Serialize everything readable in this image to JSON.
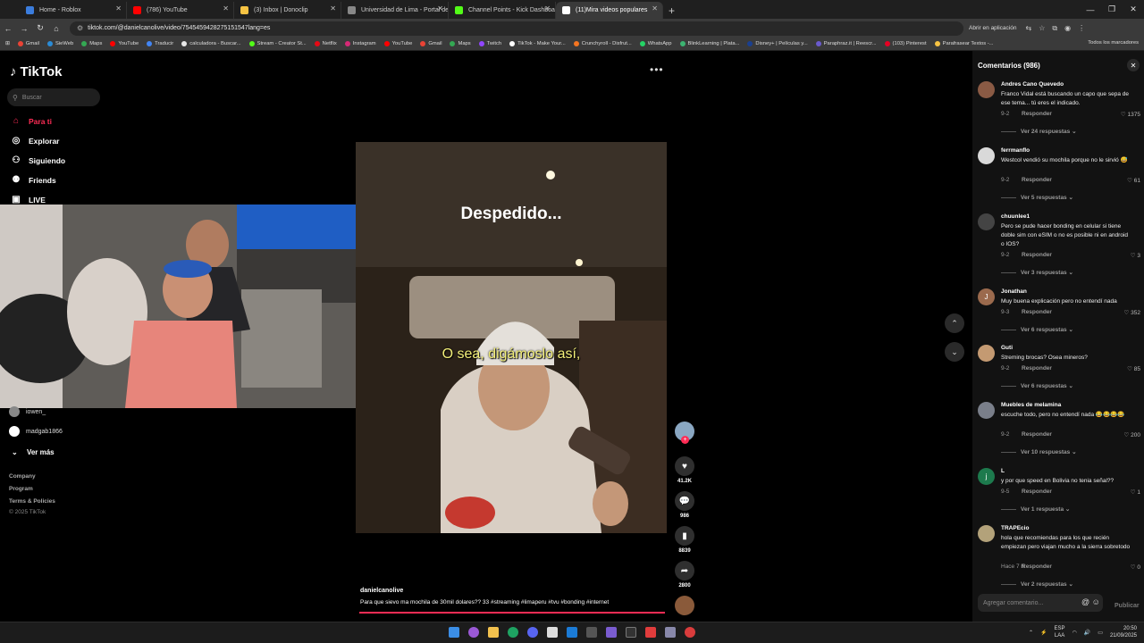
{
  "browser": {
    "tabs": [
      {
        "label": "Home - Roblox",
        "color": "#3b7ddd",
        "active": false
      },
      {
        "label": "(786) YouTube",
        "color": "#ff0000",
        "active": false
      },
      {
        "label": "(3) Inbox | Donoclip",
        "color": "#f6c343",
        "active": false
      },
      {
        "label": "Universidad de Lima - Portal de",
        "color": "#888888",
        "active": false
      },
      {
        "label": "Channel Points - Kick Dashboa",
        "color": "#53fc18",
        "active": false
      },
      {
        "label": "(11)Mira videos populares",
        "color": "#ffffff",
        "active": true
      }
    ],
    "url": "tiktok.com/@danielcanolive/video/7545459428275151547lang=es",
    "open_in_app": "Abrir en aplicación",
    "bookmarks": [
      {
        "label": "Gmail",
        "color": "#ea4335"
      },
      {
        "label": "SieWeb",
        "color": "#2a8bd6"
      },
      {
        "label": "Maps",
        "color": "#34a853"
      },
      {
        "label": "YouTube",
        "color": "#ff0000"
      },
      {
        "label": "Traducir",
        "color": "#4285f4"
      },
      {
        "label": "calculadora - Buscar...",
        "color": "#e8e8e8"
      },
      {
        "label": "Stream - Creator St...",
        "color": "#53fc18"
      },
      {
        "label": "Netflix",
        "color": "#e50914"
      },
      {
        "label": "Instagram",
        "color": "#d62976"
      },
      {
        "label": "YouTube",
        "color": "#ff0000"
      },
      {
        "label": "Gmail",
        "color": "#ea4335"
      },
      {
        "label": "Maps",
        "color": "#34a853"
      },
      {
        "label": "Twitch",
        "color": "#9146ff"
      },
      {
        "label": "TikTok - Make Your...",
        "color": "#ffffff"
      },
      {
        "label": "Crunchyroll - Disfrut...",
        "color": "#f47521"
      },
      {
        "label": "WhatsApp",
        "color": "#25d366"
      },
      {
        "label": "BlinkLearning | Plata...",
        "color": "#3cb371"
      },
      {
        "label": "Disney+ | Películas y...",
        "color": "#1a3f8f"
      },
      {
        "label": "Paraphraz.it | Reescr...",
        "color": "#6a5acd"
      },
      {
        "label": "(103) Pinterest",
        "color": "#e60023"
      },
      {
        "label": "Parafrasear Textos -...",
        "color": "#f6c343"
      }
    ],
    "all_bookmarks": "Todos los marcadores"
  },
  "sidebar": {
    "logo": "TikTok",
    "search_placeholder": "Buscar",
    "nav": [
      {
        "label": "Para ti",
        "icon": "home-icon"
      },
      {
        "label": "Explorar",
        "icon": "compass-icon"
      },
      {
        "label": "Siguiendo",
        "icon": "following-icon"
      },
      {
        "label": "Friends",
        "icon": "friends-icon"
      },
      {
        "label": "LIVE",
        "icon": "live-icon"
      }
    ],
    "following": [
      "iowen_",
      "madgab1866"
    ],
    "see_more": "Ver más",
    "footer": [
      "Company",
      "Program",
      "Terms & Policies",
      "© 2025 TikTok"
    ]
  },
  "video": {
    "caption_top": "Despedido...",
    "caption_mid": "O sea, digámoslo así,",
    "author": "danielcanolive",
    "description": "Para que sievo ma mochila de 30mil dolares?? 33 #streaming #limaperu #tvu #bonding #internet",
    "progress": 1.0,
    "likes": "41.2K",
    "comments": "986",
    "saves": "8839",
    "shares": "2800"
  },
  "comments": {
    "header": "Comentarios (986)",
    "input_placeholder": "Agregar comentario...",
    "publish": "Publicar",
    "reply_label": "Responder",
    "items": [
      {
        "name": "Andres Cano Quevedo",
        "text": "Franco Vidal está buscando un capo que sepa de ese tema... tú eres el indicado.",
        "date": "9-2",
        "likes": "1375",
        "more": "Ver 24 respuestas",
        "avatar": "#8a5a44",
        "initial": ""
      },
      {
        "name": "ferrmanflo",
        "text": "Westcol vendió su mochila porque no le sirvió 😅",
        "date": "9-2",
        "likes": "61",
        "more": "Ver 5 respuestas",
        "avatar": "#d9d9d9",
        "initial": ""
      },
      {
        "name": "chuunlee1",
        "text": "Pero se pude hacer bonding en celular si tiene doble sim con eSIM o no es posible ni en android o IOS?",
        "date": "9-2",
        "likes": "3",
        "more": "Ver 3 respuestas",
        "avatar": "#444444",
        "initial": ""
      },
      {
        "name": "Jonathan",
        "text": "Muy buena explicación pero no entendí nada",
        "date": "9-3",
        "likes": "352",
        "more": "Ver 6 respuestas",
        "avatar": "#9b6a4d",
        "initial": "J"
      },
      {
        "name": "Guti",
        "text": "Streming brocas? Osea mineros?",
        "date": "9-2",
        "likes": "85",
        "more": "Ver 6 respuestas",
        "avatar": "#c49a72",
        "initial": ""
      },
      {
        "name": "Muebles de melamina",
        "text": "escuche todo, pero no entendí nada 😂😂😂😂",
        "date": "9-2",
        "likes": "200",
        "more": "Ver 10 respuestas",
        "avatar": "#7a7f8a",
        "initial": ""
      },
      {
        "name": "L",
        "text": "y por que speed en Bolivia no tenia señal??",
        "date": "9-5",
        "likes": "1",
        "more": "Ver 1 respuesta",
        "avatar": "#1d7a4d",
        "initial": "j"
      },
      {
        "name": "TRAPEcio",
        "text": "hola que recomiendas para los que recién empiezan pero viajan mucho a la sierra sobretodo",
        "date": "Hace 7 h",
        "likes": "0",
        "more": "Ver 2 respuestas",
        "avatar": "#b3a27a",
        "initial": ""
      }
    ]
  },
  "taskbar": {
    "lang": "ESP",
    "lang2": "LAA",
    "time": "20:50",
    "date": "21/09/2025"
  }
}
